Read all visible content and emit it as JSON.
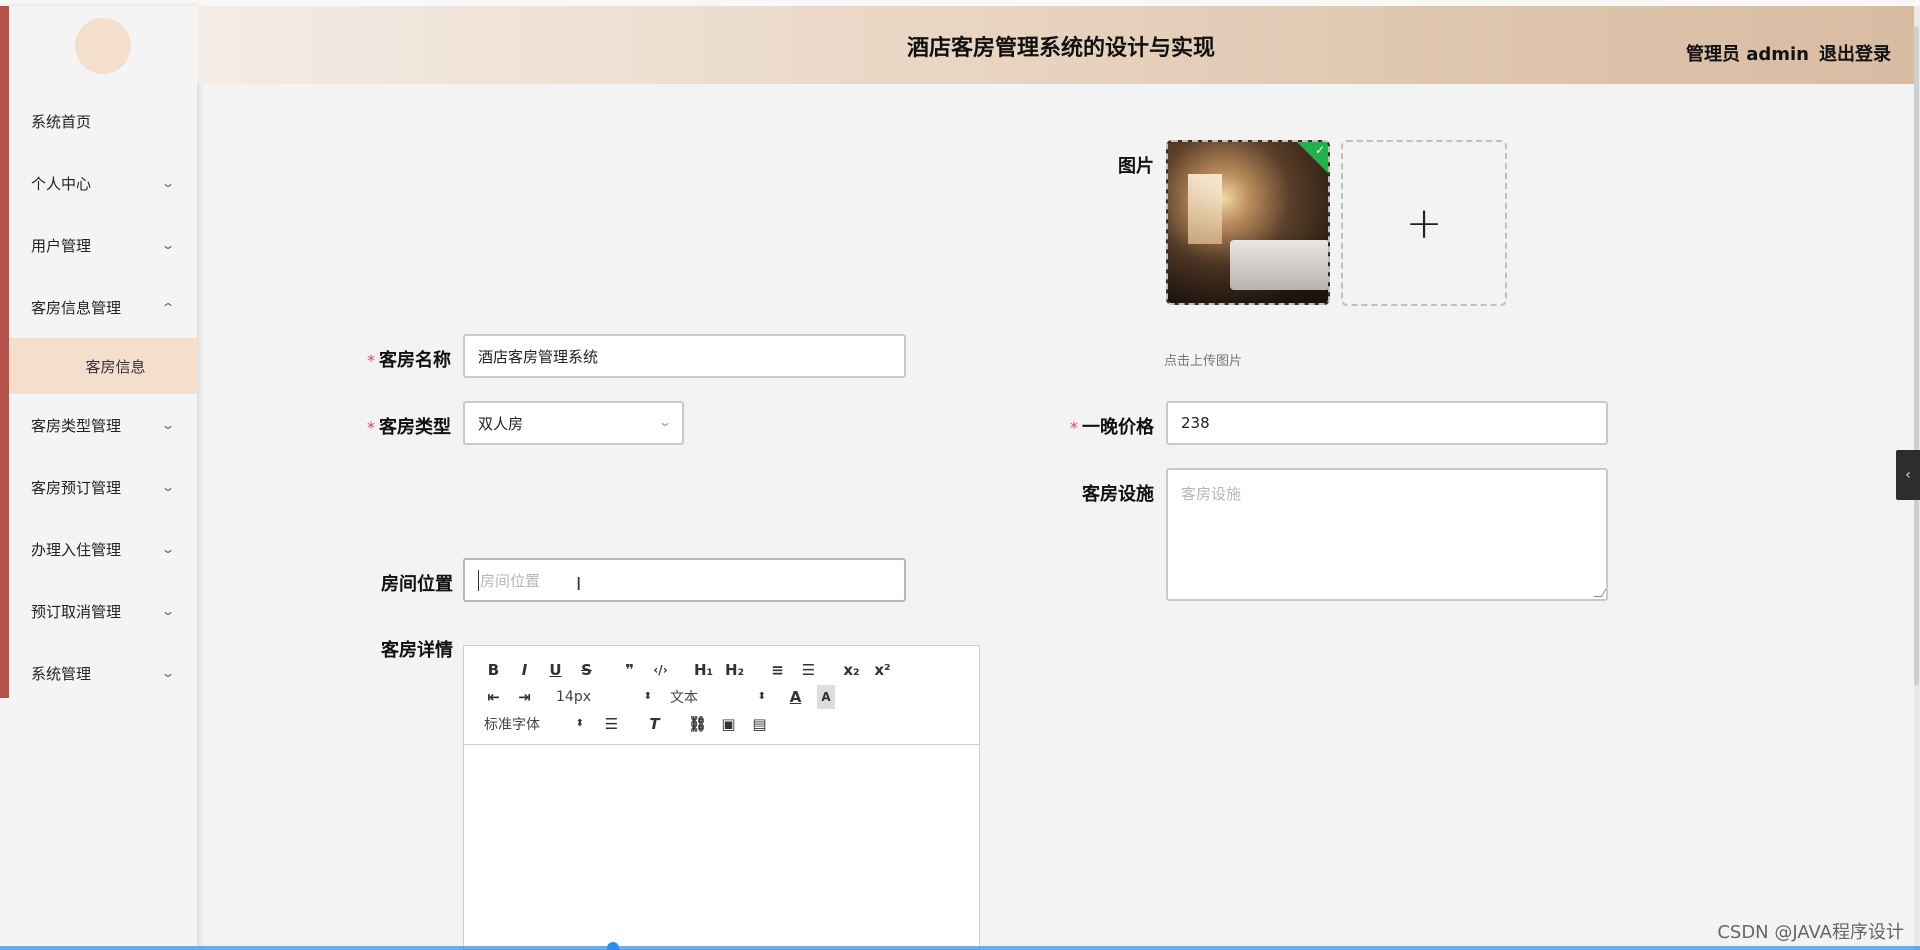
{
  "header": {
    "title": "酒店客房管理系统的设计与实现",
    "user_label": "管理员 admin",
    "logout_label": "退出登录"
  },
  "sidebar": {
    "items": [
      {
        "label": "系统首页",
        "chevron": ""
      },
      {
        "label": "个人中心",
        "chevron": "down"
      },
      {
        "label": "用户管理",
        "chevron": "down"
      },
      {
        "label": "客房信息管理",
        "chevron": "up"
      },
      {
        "label": "客房类型管理",
        "chevron": "down"
      },
      {
        "label": "客房预订管理",
        "chevron": "down"
      },
      {
        "label": "办理入住管理",
        "chevron": "down"
      },
      {
        "label": "预订取消管理",
        "chevron": "down"
      },
      {
        "label": "系统管理",
        "chevron": "down"
      }
    ],
    "active_sub": "客房信息",
    "chevron_glyph": "⌄"
  },
  "form": {
    "name_label": "客房名称",
    "name_value": "酒店客房管理系统",
    "type_label": "客房类型",
    "type_value": "双人房",
    "image_label": "图片",
    "upload_hint": "点击上传图片",
    "upload_plus": "+",
    "price_label": "一晚价格",
    "price_value": "238",
    "facility_label": "客房设施",
    "facility_placeholder": "客房设施",
    "location_label": "房间位置",
    "location_placeholder": "房间位置",
    "detail_label": "客房详情",
    "required_mark": "*"
  },
  "editor": {
    "row1": [
      "B",
      "I",
      "U",
      "S",
      "❞",
      "‹/›",
      "H₁",
      "H₂",
      "≡",
      "☰",
      "x₂",
      "x²"
    ],
    "row2_size": "14px",
    "row2_text": "文本",
    "row3_font": "标准字体"
  },
  "watermark": "CSDN @JAVA程序设计",
  "colors": {
    "accent": "#b5534a",
    "active_bg": "#f4dfcc",
    "required": "#e04848"
  }
}
